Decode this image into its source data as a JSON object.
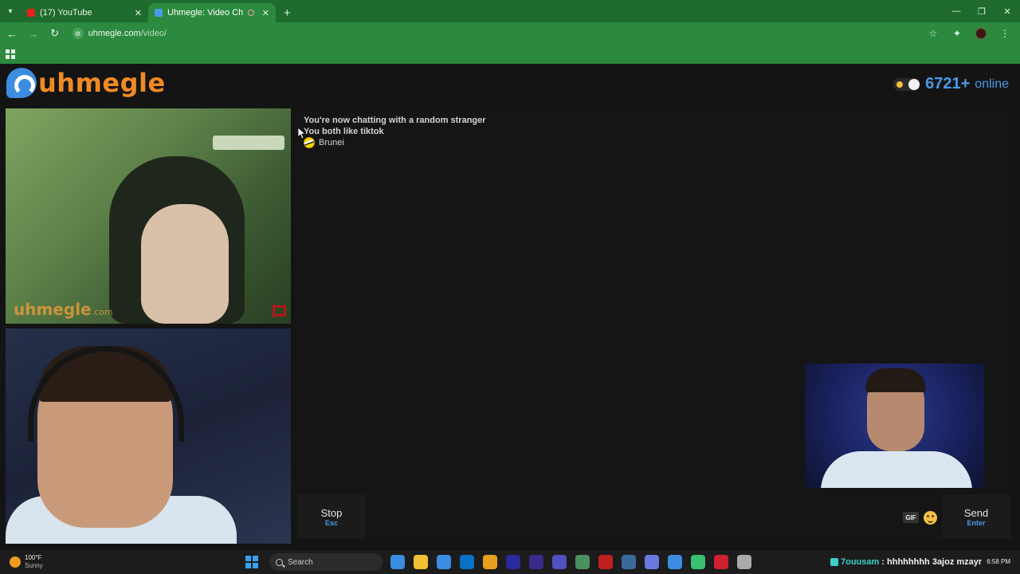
{
  "browser": {
    "tabs": [
      {
        "title": "(17) YouTube",
        "active": false,
        "favicon_color": "#e62117"
      },
      {
        "title": "Uhmegle: Video Chat | Ome",
        "active": true,
        "favicon_color": "#4a9be8"
      }
    ],
    "url_host": "uhmegle.com",
    "url_path": "/video/",
    "theme_color": "#2b8a3e"
  },
  "site": {
    "logo_text": "uhmegle",
    "online_count": "6721+",
    "online_label": "online"
  },
  "stranger_video": {
    "watermark": "uhmegle",
    "watermark_suffix": ".com"
  },
  "chat": {
    "messages": [
      "You're now chatting with a random stranger",
      "You both like tiktok"
    ],
    "country": "Brunei"
  },
  "controls": {
    "stop_label": "Stop",
    "stop_key": "Esc",
    "gif_label": "GIF",
    "send_label": "Send",
    "send_key": "Enter"
  },
  "taskbar": {
    "weather_temp": "100°F",
    "weather_condition": "Sunny",
    "search_placeholder": "Search",
    "ticker_user": "7ouusam",
    "ticker_text": ": hhhhhhhh 3ajoz mzayr",
    "clock_time": "6:58 PM",
    "app_colors": [
      "#3a8de0",
      "#f0c030",
      "#3a8de0",
      "#0a72c4",
      "#e8a020",
      "#2a2a9a",
      "#3a2a8a",
      "#5050c0",
      "#4a9060",
      "#c02020",
      "#3a6a9a",
      "#6a78e0",
      "#3a8de0",
      "#3ac070",
      "#d02030",
      "#aaaaaa"
    ]
  }
}
